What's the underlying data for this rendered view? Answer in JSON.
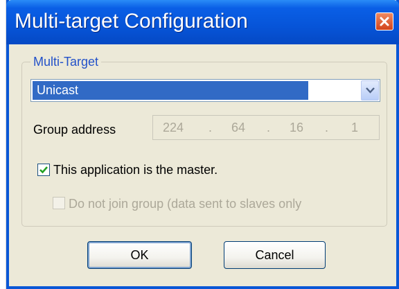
{
  "window": {
    "title": "Multi-target Configuration"
  },
  "multi_target": {
    "legend": "Multi-Target",
    "mode_selected": "Unicast"
  },
  "group_address": {
    "label": "Group address",
    "octets": [
      "224",
      "64",
      "16",
      "1"
    ],
    "separator": "."
  },
  "master_checkbox": {
    "label": "This application is the master.",
    "checked": true
  },
  "no_join_checkbox": {
    "label": "Do not join group (data sent to slaves only",
    "checked": false,
    "enabled": false
  },
  "buttons": {
    "ok_label": "OK",
    "cancel_label": "Cancel"
  },
  "colors": {
    "titlebar": "#0654d8",
    "close": "#d2431a",
    "selection": "#316ac5",
    "legend_text": "#2251c9",
    "check_mark": "#21a121",
    "disabled_text": "#aca899"
  },
  "icons": {
    "close": "close-icon",
    "dropdown": "chevron-down-icon",
    "check": "checkmark-icon"
  }
}
